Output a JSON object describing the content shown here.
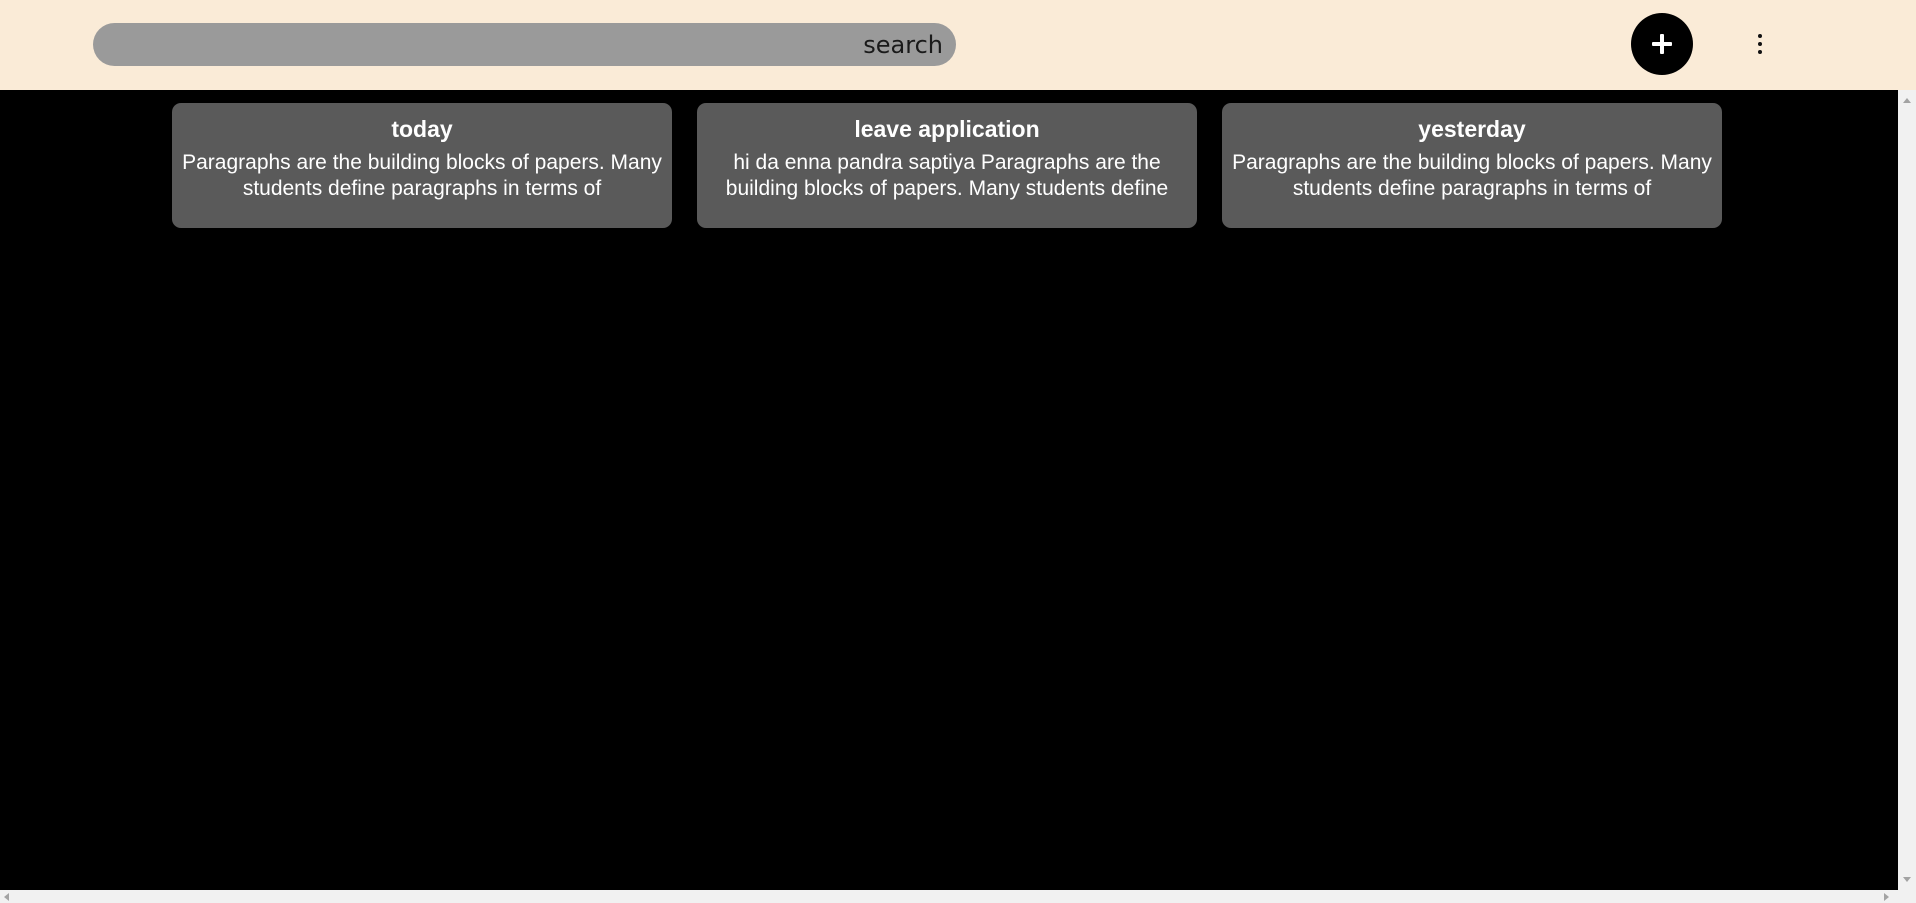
{
  "header": {
    "search": {
      "label": "search",
      "value": ""
    },
    "add_button_icon": "plus-icon",
    "menu_button_icon": "kebab-menu-icon"
  },
  "notes": [
    {
      "title": "today",
      "body": "Paragraphs are the building blocks of papers. Many students define paragraphs in terms of"
    },
    {
      "title": "leave application",
      "body": "hi da enna pandra saptiya Paragraphs are the building blocks of papers. Many students define"
    },
    {
      "title": "yesterday",
      "body": "Paragraphs are the building blocks of papers. Many students define paragraphs in terms of"
    }
  ],
  "colors": {
    "header_background": "#faebd7",
    "page_background": "#000000",
    "search_background": "#9a9a9a",
    "card_background": "#5a5a5a",
    "card_text": "#ffffff"
  }
}
